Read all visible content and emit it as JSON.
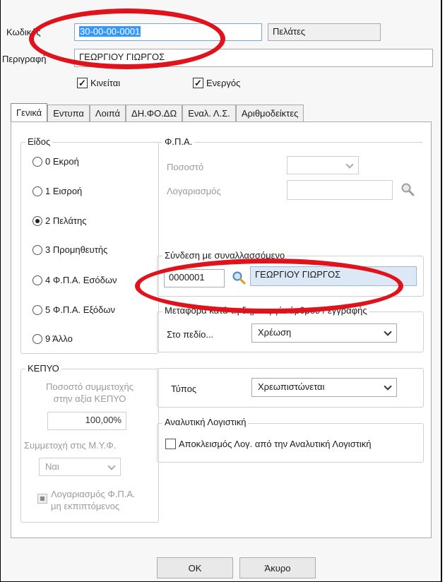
{
  "header": {
    "code_label": "Κωδικός",
    "code_value": "30-00-00-0001",
    "category_value": "Πελάτες",
    "description_label": "Περιγραφή",
    "description_value": "ΓΕΩΡΓΙΟΥ ΓΙΩΡΓΟΣ",
    "checkbox_moves_label": "Κινείται",
    "checkbox_moves_checked": true,
    "checkbox_active_label": "Ενεργός",
    "checkbox_active_checked": true
  },
  "tabs": [
    {
      "label": "Γενικά",
      "active": true
    },
    {
      "label": "Εντυπα",
      "active": false
    },
    {
      "label": "Λοιπά",
      "active": false
    },
    {
      "label": "ΔΗ.ΦΟ.ΔΩ",
      "active": false
    },
    {
      "label": "Εναλ. Λ.Σ.",
      "active": false
    },
    {
      "label": "Αριθμοδείκτες",
      "active": false
    }
  ],
  "kind": {
    "title": "Είδος",
    "options": [
      {
        "label": "0 Εκροή",
        "selected": false
      },
      {
        "label": "1 Εισροή",
        "selected": false
      },
      {
        "label": "2 Πελάτης",
        "selected": true
      },
      {
        "label": "3 Προμηθευτής",
        "selected": false
      },
      {
        "label": "4 Φ.Π.Α. Εσόδων",
        "selected": false
      },
      {
        "label": "5 Φ.Π.Α. Εξόδων",
        "selected": false
      },
      {
        "label": "9 Άλλο",
        "selected": false
      }
    ]
  },
  "kepyo": {
    "title": "ΚΕΠΥΟ",
    "percentage_label_line1": "Ποσοστό συμμετοχής",
    "percentage_label_line2": "στην αξία ΚΕΠΥΟ",
    "percentage_value": "100,00%",
    "participation_label": "Συμμετοχή στις Μ.Υ.Φ.",
    "participation_value": "Ναι",
    "vat_account_label_line1": "Λογαριασμός Φ.Π.Α.",
    "vat_account_label_line2": "μη εκπιπτόμενος"
  },
  "vat": {
    "title": "Φ.Π.Α.",
    "percentage_label": "Ποσοστό",
    "percentage_value": "",
    "account_label": "Λογαριασμός",
    "account_value": ""
  },
  "link": {
    "title": "Σύνδεση με συναλλασσόμενο",
    "code_value": "0000001",
    "name_value": "ΓΕΩΡΓΙΟΥ ΓΙΩΡΓΟΣ"
  },
  "transfer": {
    "title": "Μεταφορά κατά τη δημιουργία άρθρου / εγγραφής",
    "field_label": "Στο πεδίο...",
    "field_value": "Χρέωση"
  },
  "type": {
    "label": "Τύπος",
    "value": "Χρεωπιστώνεται"
  },
  "analytics": {
    "title": "Αναλυτική Λογιστική",
    "exclude_label": "Αποκλεισμός Λογ. από την Αναλυτική Λογιστική",
    "exclude_checked": false
  },
  "footer": {
    "ok_label": "OK",
    "cancel_label": "Άκυρο"
  },
  "colors": {
    "annotation": "#e0131c",
    "selection": "#3399ff",
    "highlight_field": "#dce8f5"
  }
}
